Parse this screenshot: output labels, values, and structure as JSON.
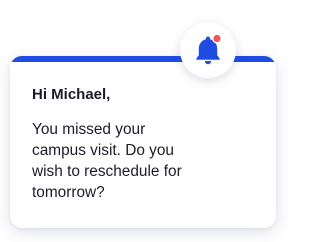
{
  "notification": {
    "greeting": "Hi Michael,",
    "message_lines": [
      "You missed your",
      "campus visit. Do you",
      "wish to reschedule for",
      "tomorrow?"
    ],
    "icon": "bell-icon",
    "has_unread_dot": true
  },
  "colors": {
    "accent": "#1f4de4",
    "badge": "#f2545b",
    "text": "#1c1c28",
    "card_background": "#ffffff"
  }
}
